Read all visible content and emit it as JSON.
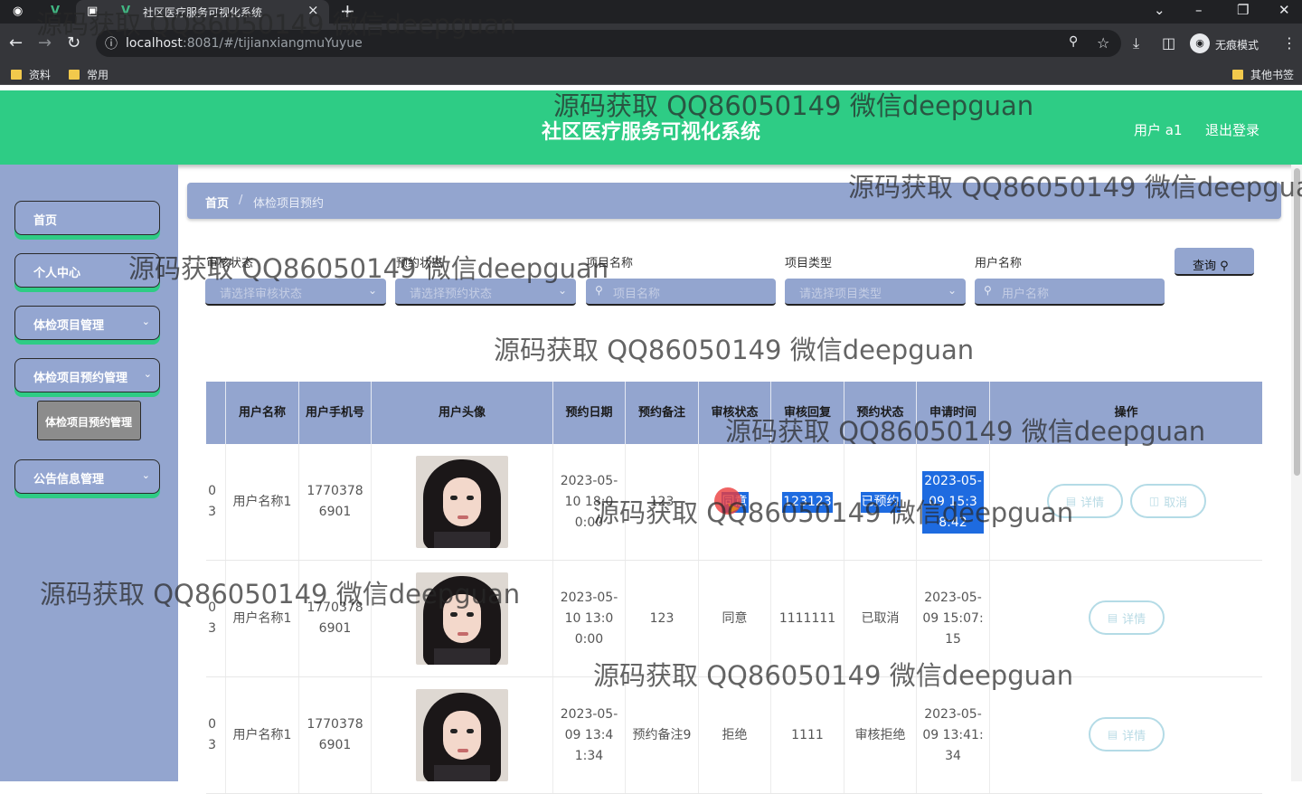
{
  "browser": {
    "tab_title": "社区医疗服务可视化系统",
    "url_host": "localhost",
    "url_path": ":8081/#/tijianxiangmuYuyue",
    "incognito_label": "无痕模式",
    "bookmarks": [
      "资料",
      "常用"
    ],
    "other_bookmarks": "其他书签"
  },
  "header": {
    "title": "社区医疗服务可视化系统",
    "user": "用户 a1",
    "logout": "退出登录"
  },
  "sidebar": {
    "items": [
      {
        "label": "首页"
      },
      {
        "label": "个人中心"
      },
      {
        "label": "体检项目管理"
      },
      {
        "label": "体检项目预约管理"
      },
      {
        "label": "公告信息管理"
      }
    ],
    "submenu_active": "体检项目预约管理"
  },
  "breadcrumb": {
    "home": "首页",
    "separator": "/",
    "current": "体检项目预约"
  },
  "filters": {
    "audit_status": {
      "label": "审核状态",
      "placeholder": "请选择审核状态"
    },
    "booking_status": {
      "label": "预约状态",
      "placeholder": "请选择预约状态"
    },
    "item_name": {
      "label": "项目名称",
      "placeholder": "项目名称"
    },
    "item_type": {
      "label": "项目类型",
      "placeholder": "请选择项目类型"
    },
    "user_name": {
      "label": "用户名称",
      "placeholder": "用户名称"
    },
    "query_button": "查询"
  },
  "table": {
    "headers": [
      "用户名称",
      "用户手机号",
      "用户头像",
      "预约日期",
      "预约备注",
      "审核状态",
      "审核回复",
      "预约状态",
      "申请时间",
      "操作"
    ],
    "rows": [
      {
        "idx": "0 3",
        "name": "用户名称1",
        "phone": "17703786901",
        "date": "2023-05-10 18:00:00",
        "remark": "123",
        "audit": "同意",
        "reply": "123123",
        "status": "已预约",
        "apply_time": "2023-05-09 15:38:42",
        "actions": [
          "详情",
          "取消"
        ]
      },
      {
        "idx": "0 3",
        "name": "用户名称1",
        "phone": "17703786901",
        "date": "2023-05-10 13:00:00",
        "remark": "123",
        "audit": "同意",
        "reply": "1111111",
        "status": "已取消",
        "apply_time": "2023-05-09 15:07:15",
        "actions": [
          "详情"
        ]
      },
      {
        "idx": "0 3",
        "name": "用户名称1",
        "phone": "17703786901",
        "date": "2023-05-09 13:41:34",
        "remark": "预约备注9",
        "audit": "拒绝",
        "reply": "1111",
        "status": "审核拒绝",
        "apply_time": "2023-05-09 13:41:34",
        "actions": [
          "详情"
        ]
      }
    ]
  },
  "watermark": "源码获取 QQ86050149 微信deepguan",
  "colors": {
    "header_green": "#2ecc85",
    "sidebar_blue": "#93a5cf",
    "highlight": "#1e6be0"
  }
}
